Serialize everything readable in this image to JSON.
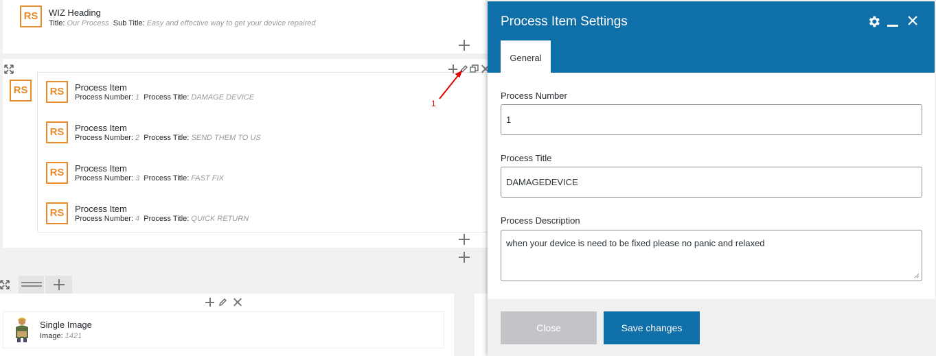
{
  "wiz_heading": {
    "badge": "RS",
    "title": "WIZ Heading",
    "title_key": "Title",
    "title_value": "Our Process",
    "subtitle_key": "Sub Title",
    "subtitle_value": "Easy and effective way to get your device repaired"
  },
  "process_container": {
    "badge": "RS",
    "annotation_number": "1",
    "items": [
      {
        "badge": "RS",
        "title": "Process Item",
        "number_key": "Process Number",
        "number_value": "1",
        "ptitle_key": "Process Title",
        "ptitle_value": "DAMAGE DEVICE"
      },
      {
        "badge": "RS",
        "title": "Process Item",
        "number_key": "Process Number",
        "number_value": "2",
        "ptitle_key": "Process Title",
        "ptitle_value": "SEND THEM TO US"
      },
      {
        "badge": "RS",
        "title": "Process Item",
        "number_key": "Process Number",
        "number_value": "3",
        "ptitle_key": "Process Title",
        "ptitle_value": "FAST FIX"
      },
      {
        "badge": "RS",
        "title": "Process Item",
        "number_key": "Process Number",
        "number_value": "4",
        "ptitle_key": "Process Title",
        "ptitle_value": "QUICK RETURN"
      }
    ]
  },
  "single_image": {
    "title": "Single Image",
    "key": "Image",
    "value": "1421"
  },
  "modal": {
    "title": "Process Item Settings",
    "tab_general": "General",
    "process_number_label": "Process Number",
    "process_number_value": "1",
    "process_title_label": "Process Title",
    "process_title_value": "DAMAGEDEVICE",
    "process_description_label": "Process Description",
    "process_description_value": "when your device is need to be fixed please no panic and relaxed",
    "close_label": "Close",
    "save_label": "Save changes"
  },
  "colors": {
    "accent": "#0f6fa8",
    "badge": "#e98b2a",
    "annotation": "#e00000"
  }
}
